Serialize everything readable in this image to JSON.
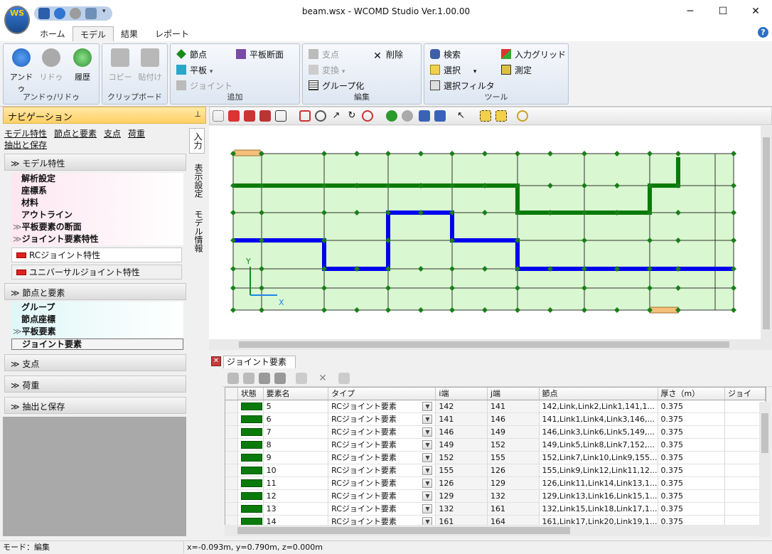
{
  "window": {
    "title": "beam.wsx - WCOMD Studio Ver.1.00.00",
    "app_logo_text": "WS"
  },
  "tabs": [
    "ホーム",
    "モデル",
    "結果",
    "レポート"
  ],
  "ribbon": {
    "undo_group": {
      "label": "アンドゥ/リドゥ",
      "undo": "アンドゥ",
      "redo": "リドゥ",
      "history": "履歴"
    },
    "clipboard_group": {
      "label": "クリップボード",
      "copy": "コピー",
      "paste": "貼付け"
    },
    "add_group": {
      "label": "追加",
      "node": "節点",
      "plate_section": "平板断面",
      "plate": "平板",
      "joint": "ジョイント"
    },
    "edit_group": {
      "label": "編集",
      "support": "支点",
      "delete": "削除",
      "convert": "変換",
      "group": "グループ化"
    },
    "tool_group": {
      "label": "ツール",
      "search": "検索",
      "input_grid": "入力グリッド",
      "select": "選択",
      "measure": "測定",
      "select_filter": "選択フィルタ"
    }
  },
  "nav": {
    "title": "ナビゲーション",
    "links": [
      "モデル特性",
      "節点と要素",
      "支点",
      "荷重",
      "抽出と保存"
    ],
    "model_section": "モデル特性",
    "model_items": [
      "解析設定",
      "座標系",
      "材料",
      "アウトライン",
      "平板要素の断面",
      "ジョイント要素特性"
    ],
    "joint_props": [
      "RCジョイント特性",
      "ユニバーサルジョイント特性"
    ],
    "nodes_section": "節点と要素",
    "node_items": [
      "グループ",
      "節点座標",
      "平板要素",
      "ジョイント要素"
    ],
    "support_section": "支点",
    "load_section": "荷重",
    "extract_section": "抽出と保存",
    "vtabs": [
      "入力",
      "表示設定",
      "モデル情報"
    ]
  },
  "grid": {
    "tab_label": "ジョイント要素",
    "columns": [
      "状態",
      "要素名",
      "タイプ",
      "i端",
      "j端",
      "節点",
      "厚さ（m）",
      "ジョイ"
    ],
    "rows": [
      {
        "name": "5",
        "type": "RCジョイント要素",
        "i": "142",
        "j": "141",
        "nodes": "142,Link,Link2,Link1,141,1...",
        "thick": "0.375"
      },
      {
        "name": "6",
        "type": "RCジョイント要素",
        "i": "141",
        "j": "146",
        "nodes": "141,Link1,Link4,Link3,146,...",
        "thick": "0.375"
      },
      {
        "name": "7",
        "type": "RCジョイント要素",
        "i": "146",
        "j": "149",
        "nodes": "146,Link3,Link6,Link5,149,...",
        "thick": "0.375"
      },
      {
        "name": "8",
        "type": "RCジョイント要素",
        "i": "149",
        "j": "152",
        "nodes": "149,Link5,Link8,Link7,152,...",
        "thick": "0.375"
      },
      {
        "name": "9",
        "type": "RCジョイント要素",
        "i": "152",
        "j": "155",
        "nodes": "152,Link7,Link10,Link9,155...",
        "thick": "0.375"
      },
      {
        "name": "10",
        "type": "RCジョイント要素",
        "i": "155",
        "j": "126",
        "nodes": "155,Link9,Link12,Link11,12...",
        "thick": "0.375"
      },
      {
        "name": "11",
        "type": "RCジョイント要素",
        "i": "126",
        "j": "129",
        "nodes": "126,Link11,Link14,Link13,1...",
        "thick": "0.375"
      },
      {
        "name": "12",
        "type": "RCジョイント要素",
        "i": "129",
        "j": "132",
        "nodes": "129,Link13,Link16,Link15,1...",
        "thick": "0.375"
      },
      {
        "name": "13",
        "type": "RCジョイント要素",
        "i": "132",
        "j": "161",
        "nodes": "132,Link15,Link18,Link17,1...",
        "thick": "0.375"
      },
      {
        "name": "14",
        "type": "RCジョイント要素",
        "i": "161",
        "j": "164",
        "nodes": "161,Link17,Link20,Link19,1...",
        "thick": "0.375"
      }
    ]
  },
  "axes": {
    "x": "X",
    "y": "Y"
  },
  "status": {
    "mode": "モード：編集",
    "coords": "x=-0.093m, y=0.790m, z=0.000m"
  },
  "colors": {
    "green_path": "#0a7a0a",
    "blue_path": "#0000ee",
    "panel_fill": "#d9f7d0",
    "node": "#1a7f1a"
  }
}
